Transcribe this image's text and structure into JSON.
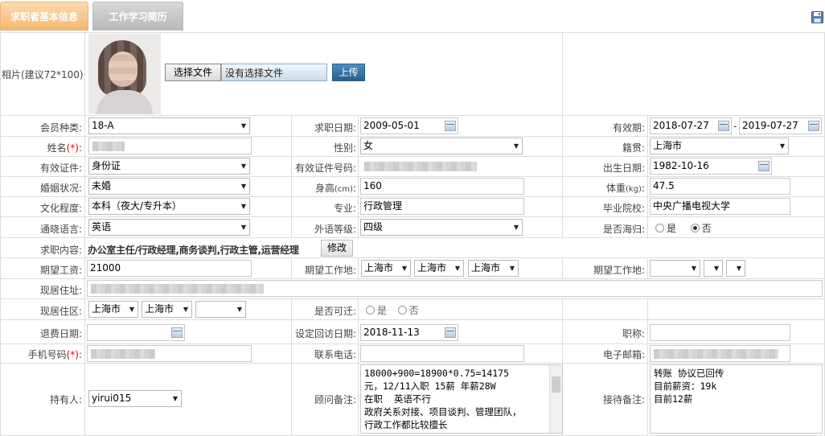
{
  "tabs": [
    "求职者基本信息",
    "工作学习简历"
  ],
  "icons": {
    "save": "save-icon",
    "calendar": "calendar-icon"
  },
  "photo": {
    "label": "相片(建议72*100):",
    "choose_file": "选择文件",
    "no_file": "没有选择文件",
    "upload": "上传"
  },
  "labels": {
    "member_type": "会员种类:",
    "apply_date": "求职日期:",
    "valid_period": "有效期:",
    "name": "姓名",
    "gender": "性别:",
    "native_place": "籍贯:",
    "id_type": "有效证件:",
    "id_number": "有效证件号码:",
    "birth_date": "出生日期:",
    "marital": "婚姻状况:",
    "height": "身高",
    "height_unit": "(cm)",
    "weight": "体重",
    "weight_unit": "(kg)",
    "education": "文化程度:",
    "major": "专业:",
    "school": "毕业院校:",
    "language": "通晓语言:",
    "foreign_level": "外语等级:",
    "overseas": "是否海归:",
    "job_content": "求职内容:",
    "modify": "修改",
    "expected_salary": "期望工资:",
    "expected_location1": "期望工作地:",
    "expected_location2": "期望工作地:",
    "address": "现居住址:",
    "district": "现居住区:",
    "relocate": "是否可迁:",
    "refund_date": "退费日期:",
    "return_visit_date": "设定回访日期:",
    "title": "职称:",
    "mobile": "手机号码",
    "phone": "联系电话:",
    "email": "电子邮箱:",
    "holder": "持有人:",
    "consultant_note": "顾问备注:",
    "reception_note": "接待备注:",
    "req_mark": "(*)",
    "colon": ":",
    "yes": "是",
    "no": "否"
  },
  "values": {
    "member_type": "18-A",
    "apply_date": "2009-05-01",
    "valid_from": "2018-07-27",
    "valid_sep": "-",
    "valid_to": "2019-07-27",
    "gender": "女",
    "native_place": "上海市",
    "id_type": "身份证",
    "birth_date": "1982-10-16",
    "marital": "未婚",
    "height": "160",
    "weight": "47.5",
    "education": "本科（夜大/专升本）",
    "major": "行政管理",
    "school": "中央广播电视大学",
    "language": "英语",
    "foreign_level": "四级",
    "overseas": "否",
    "job_content": "办公室主任/行政经理,商务谈判,行政主管,运营经理",
    "expected_salary": "21000",
    "expected_loc1": [
      "上海市",
      "上海市",
      "上海市"
    ],
    "district": [
      "上海市",
      "上海市",
      ""
    ],
    "return_visit_date": "2018-11-13",
    "holder": "yirui015",
    "consultant_note": "18000+900=18900*0.75=14175\n元，12/11入职 15薪 年薪28W\n在职  英语不行\n政府关系对接、项目谈判、管理团队，\n行政工作都比较擅长",
    "reception_note": "转账 协议已回传\n目前薪资：19k\n目前12薪"
  },
  "colors": {
    "tab_active": "#f4b770",
    "tab_inactive": "#bdbdbd",
    "upload_btn": "#2e6f9c",
    "required": "#ee0000",
    "border": "#dcdcdc"
  }
}
